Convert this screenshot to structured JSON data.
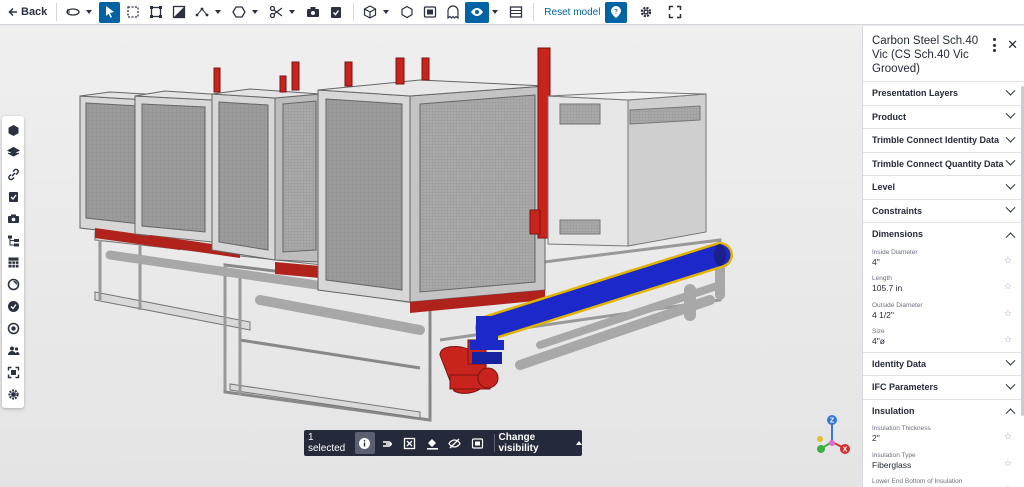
{
  "toolbar": {
    "back_label": "Back",
    "reset_label": "Reset model",
    "icons": [
      "orbit-icon",
      "select-arrow-icon",
      "box-select-icon",
      "fit-frame-icon",
      "section-icon",
      "measure-icon",
      "shape-icon",
      "clip-scissors-icon",
      "snapshot-icon",
      "todo-icon",
      "cube-view-icon",
      "cube-outline-icon",
      "layers-panel-icon",
      "ghost-icon",
      "visibility-eye-icon",
      "grid-icon",
      "help-marker-icon",
      "settings-gear-icon",
      "fullscreen-icon"
    ]
  },
  "left_rail": {
    "icons": [
      "model-cube-icon",
      "layers-icon",
      "link-icon",
      "clipboard-check-icon",
      "camera-icon",
      "tree-icon",
      "table-icon",
      "swirl-icon",
      "check-circle-icon",
      "target-icon",
      "users-icon",
      "frame-icon",
      "gear-icon"
    ]
  },
  "selection_bar": {
    "count_text": "1 selected",
    "change_visibility": "Change visibility"
  },
  "gizmo": {
    "z": "Z",
    "x": "X"
  },
  "panel": {
    "title": "Carbon Steel Sch.40 Vic (CS Sch.40 Vic Grooved)",
    "sections": [
      {
        "name": "Presentation Layers",
        "expanded": false
      },
      {
        "name": "Product",
        "expanded": false
      },
      {
        "name": "Trimble Connect Identity Data",
        "expanded": false
      },
      {
        "name": "Trimble Connect Quantity Data",
        "expanded": false
      },
      {
        "name": "Level",
        "expanded": false
      },
      {
        "name": "Constraints",
        "expanded": false
      },
      {
        "name": "Dimensions",
        "expanded": true,
        "props": [
          {
            "label": "Inside Diameter",
            "value": "4\""
          },
          {
            "label": "Length",
            "value": "105.7 in"
          },
          {
            "label": "Outside Diameter",
            "value": "4 1/2\""
          },
          {
            "label": "Size",
            "value": "4\"ø"
          }
        ]
      },
      {
        "name": "Identity Data",
        "expanded": false
      },
      {
        "name": "IFC Parameters",
        "expanded": false
      },
      {
        "name": "Insulation",
        "expanded": true,
        "props": [
          {
            "label": "Insulation Thickness",
            "value": "2\""
          },
          {
            "label": "Insulation Type",
            "value": "Fiberglass"
          },
          {
            "label": "Lower End Bottom of Insulation",
            "value": ""
          }
        ]
      }
    ]
  },
  "colors": {
    "accent": "#0063a3",
    "dark": "#252a3a",
    "red": "#c8231d",
    "blue": "#1c28c8"
  }
}
